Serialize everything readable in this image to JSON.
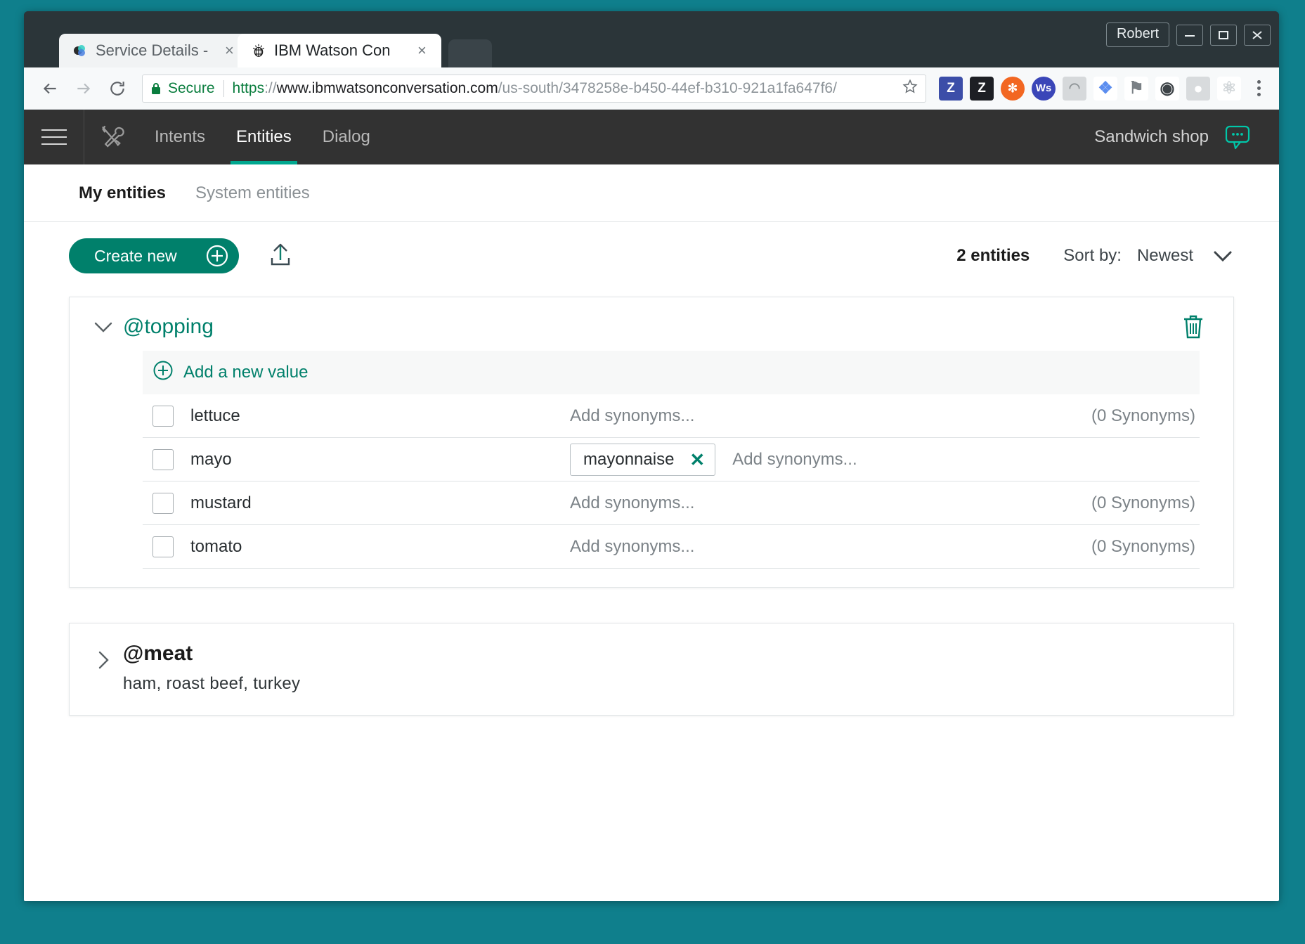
{
  "window": {
    "profile_label": "Robert",
    "minimize_icon": "minimize-icon",
    "maximize_icon": "maximize-icon",
    "close_icon": "close-icon"
  },
  "browser": {
    "tabs": [
      {
        "title": "Service Details -",
        "favicon": "bluemix-favicon",
        "active": false,
        "close_label": "×"
      },
      {
        "title": "IBM Watson Con",
        "favicon": "watson-favicon",
        "active": true,
        "close_label": "×"
      }
    ],
    "nav": {
      "back_icon": "back-arrow-icon",
      "forward_icon": "forward-arrow-icon",
      "reload_icon": "reload-icon"
    },
    "omnibox": {
      "lock_icon": "lock-icon",
      "secure_text": "Secure",
      "url_scheme": "https",
      "url_separator": "://",
      "url_host": "www.ibmwatsonconversation.com",
      "url_path": "/us-south/3478258e-b450-44ef-b310-921a1fa647f6/",
      "star_icon": "bookmark-star-icon"
    },
    "extensions": [
      {
        "name": "zotero-connector",
        "glyph": "Z",
        "bg": "#3c4ea8",
        "fg": "#ffffff"
      },
      {
        "name": "zotero-dark",
        "glyph": "Z",
        "bg": "#1d1f24",
        "fg": "#ffffff"
      },
      {
        "name": "orange-extension",
        "glyph": "✻",
        "bg": "#f26722",
        "fg": "#ffffff"
      },
      {
        "name": "ws-extension",
        "glyph": "Ws",
        "bg": "#3a46b8",
        "fg": "#ffffff"
      },
      {
        "name": "grey-extension",
        "glyph": "◠",
        "bg": "#d6d9db",
        "fg": "#8e9497"
      },
      {
        "name": "dropbox-extension",
        "glyph": "❖",
        "bg": "#ffffff",
        "fg": "#5b8def"
      },
      {
        "name": "presentation-extension",
        "glyph": "⚑",
        "bg": "#ffffff",
        "fg": "#7a8085"
      },
      {
        "name": "camera-extension",
        "glyph": "◉",
        "bg": "#ffffff",
        "fg": "#3d4347"
      },
      {
        "name": "shield-extension",
        "glyph": "●",
        "bg": "#d8dbdd",
        "fg": "#ffffff"
      },
      {
        "name": "react-extension",
        "glyph": "⚛",
        "bg": "#ffffff",
        "fg": "#cfd4d7"
      }
    ],
    "menu_icon": "kebab-menu-icon"
  },
  "app": {
    "menu_icon": "hamburger-menu-icon",
    "tools_icon": "tools-icon",
    "nav_tabs": [
      {
        "label": "Intents",
        "active": false
      },
      {
        "label": "Entities",
        "active": true
      },
      {
        "label": "Dialog",
        "active": false
      }
    ],
    "workspace_name": "Sandwich shop",
    "chat_icon": "chat-bubble-icon",
    "sub_tabs": [
      {
        "label": "My entities",
        "active": true
      },
      {
        "label": "System entities",
        "active": false
      }
    ],
    "toolbar": {
      "create_label": "Create new",
      "create_plus_icon": "plus-circle-icon",
      "upload_icon": "upload-icon",
      "entities_count": "2 entities",
      "sort_label": "Sort by:",
      "sort_value": "Newest",
      "sort_caret_icon": "chevron-down-icon"
    },
    "entities": [
      {
        "name": "@topping",
        "expanded": true,
        "collapse_icon": "chevron-down-icon",
        "delete_icon": "trash-icon",
        "add_value_label": "Add a new value",
        "add_value_icon": "plus-circle-icon",
        "values": [
          {
            "name": "lettuce",
            "synonyms": [],
            "synonyms_placeholder": "Add synonyms...",
            "synonym_count_label": "(0 Synonyms)"
          },
          {
            "name": "mayo",
            "synonyms": [
              "mayonnaise"
            ],
            "synonyms_placeholder": "Add synonyms...",
            "synonym_count_label": ""
          },
          {
            "name": "mustard",
            "synonyms": [],
            "synonyms_placeholder": "Add synonyms...",
            "synonym_count_label": "(0 Synonyms)"
          },
          {
            "name": "tomato",
            "synonyms": [],
            "synonyms_placeholder": "Add synonyms...",
            "synonym_count_label": "(0 Synonyms)"
          }
        ]
      },
      {
        "name": "@meat",
        "expanded": false,
        "collapse_icon": "chevron-right-icon",
        "values_summary": "ham,  roast beef,  turkey"
      }
    ]
  },
  "colors": {
    "accent_teal": "#00806b",
    "nav_active_underline": "#00a78f",
    "desktop": "#0f7f8c",
    "chrome_frame": "#2b3539",
    "app_header": "#323232",
    "secure_green": "#0a7d3e"
  }
}
